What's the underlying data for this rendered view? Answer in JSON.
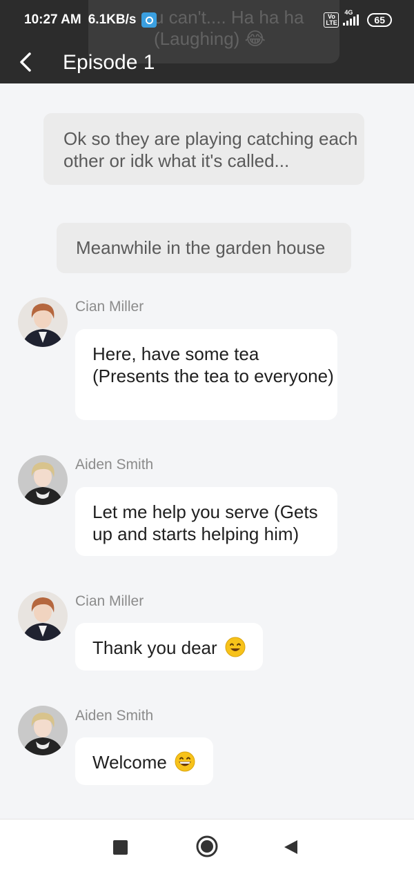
{
  "status_bar": {
    "time": "10:27 AM",
    "speed": "6.1KB/s",
    "volte_top": "Vo",
    "volte_bottom": "LTE",
    "network": "4G",
    "battery": "65"
  },
  "header": {
    "title": "Episode 1",
    "faded_text_line1": "u can't.... Ha ha ha",
    "faded_text_line2": "(Laughing) 😂"
  },
  "messages": [
    {
      "type": "narration",
      "text": "Ok so they are playing catching each other or idk what it's called..."
    },
    {
      "type": "narration",
      "text": "Meanwhile in the garden house"
    },
    {
      "type": "chat",
      "speaker": "Cian Miller",
      "text": "Here, have some tea (Presents the tea to everyone)"
    },
    {
      "type": "chat",
      "speaker": "Aiden Smith",
      "text": "Let me help you serve (Gets up and starts helping him)"
    },
    {
      "type": "chat",
      "speaker": "Cian Miller",
      "text": "Thank you dear",
      "emoji": "smiling-face-icon"
    },
    {
      "type": "chat",
      "speaker": "Aiden Smith",
      "text": "Welcome",
      "emoji": "grinning-face-icon"
    }
  ],
  "colors": {
    "header_bg": "#2c2c2c",
    "page_bg": "#f4f5f7",
    "narration_bg": "#ebebeb",
    "bubble_bg": "#ffffff",
    "emoji_yellow": "#f7c21a"
  },
  "system_nav": {
    "recent_icon": "square-icon",
    "home_icon": "circle-home-icon",
    "back_icon": "triangle-back-icon"
  }
}
